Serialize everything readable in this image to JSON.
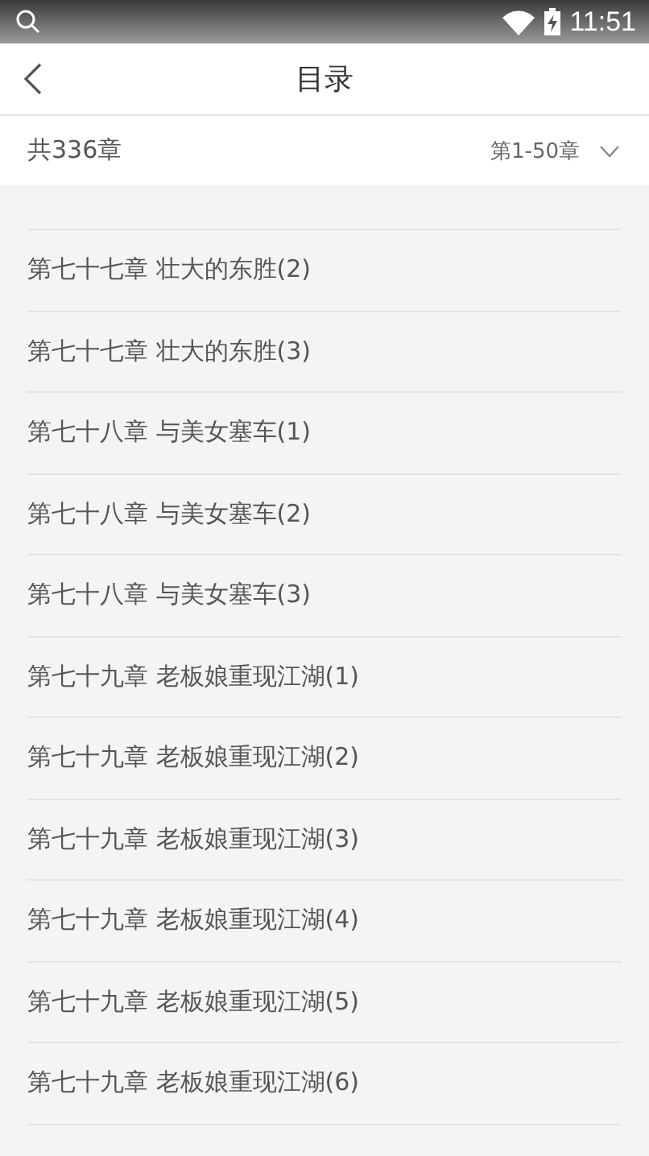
{
  "status_bar": {
    "time": "11:51"
  },
  "header": {
    "title": "目录"
  },
  "summary": {
    "total": "共336章",
    "range": "第1-50章"
  },
  "chapters": [
    {
      "number": "第七十七章",
      "title": "壮大的东胜(2)"
    },
    {
      "number": "第七十七章",
      "title": "壮大的东胜(3)"
    },
    {
      "number": "第七十八章",
      "title": "与美女塞车(1)"
    },
    {
      "number": "第七十八章",
      "title": "与美女塞车(2)"
    },
    {
      "number": "第七十八章",
      "title": "与美女塞车(3)"
    },
    {
      "number": "第七十九章",
      "title": "老板娘重现江湖(1)"
    },
    {
      "number": "第七十九章",
      "title": "老板娘重现江湖(2)"
    },
    {
      "number": "第七十九章",
      "title": "老板娘重现江湖(3)"
    },
    {
      "number": "第七十九章",
      "title": "老板娘重现江湖(4)"
    },
    {
      "number": "第七十九章",
      "title": "老板娘重现江湖(5)"
    },
    {
      "number": "第七十九章",
      "title": "老板娘重现江湖(6)"
    }
  ]
}
